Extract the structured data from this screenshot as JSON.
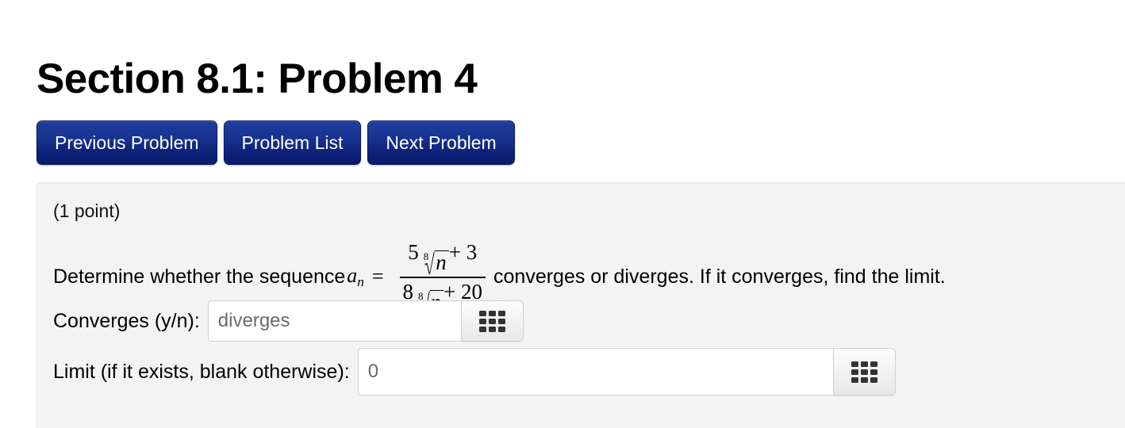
{
  "page": {
    "title": "Section 8.1: Problem 4"
  },
  "nav": {
    "buttons": [
      {
        "label": "Previous Problem",
        "name": "previous-problem-button"
      },
      {
        "label": "Problem List",
        "name": "problem-list-button"
      },
      {
        "label": "Next Problem",
        "name": "next-problem-button"
      }
    ]
  },
  "problem": {
    "points": "(1 point)",
    "statement_prefix": "Determine whether the sequence",
    "variable": "a",
    "variable_subscript": "n",
    "equals": "=",
    "statement_suffix": "converges or diverges. If it converges, find the limit.",
    "expression": {
      "numerator": {
        "coefficient": "5",
        "root_index": "8",
        "radicand": "n",
        "tail": "+ 3"
      },
      "denominator": {
        "coefficient": "8",
        "root_index": "8",
        "radicand": "n",
        "tail": "+ 20"
      }
    }
  },
  "answers": {
    "converges": {
      "label": "Converges (y/n):",
      "value": "diverges",
      "placeholder": "diverges",
      "keypad_icon": "grid-keypad-icon"
    },
    "limit": {
      "label": "Limit (if it exists, blank otherwise):",
      "value": "0",
      "placeholder": "0",
      "keypad_icon": "grid-keypad-icon"
    }
  },
  "colors": {
    "button_navy_top": "#1f3ea0",
    "button_navy_bottom": "#0a1c6e",
    "panel_background": "#f3f3f3",
    "input_text": "#6b6b6b",
    "page_background": "#ffffff"
  }
}
